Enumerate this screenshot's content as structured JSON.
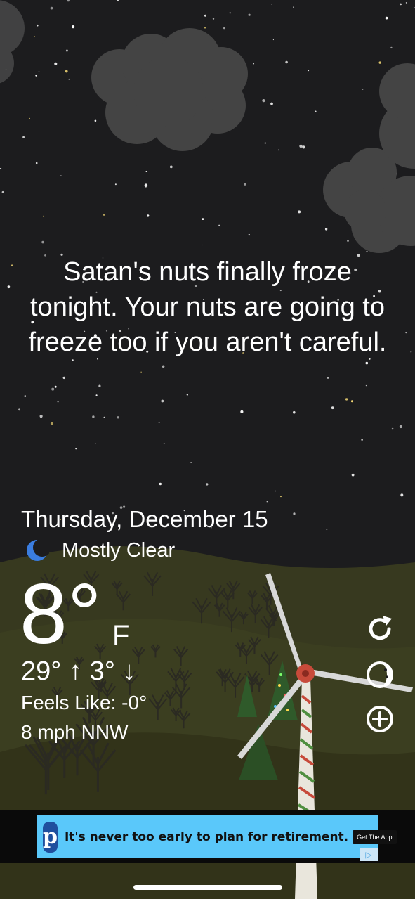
{
  "quote": "Satan's nuts finally froze tonight. Your nuts are going to freeze too if you aren't careful.",
  "date": "Thursday, December 15",
  "condition": {
    "icon": "moon-icon",
    "text": "Mostly Clear"
  },
  "temperature": {
    "value": "8°",
    "unit": "F"
  },
  "hi_lo": "29° ↑  3° ↓",
  "feels_like": "Feels Like: -0°",
  "wind": "8 mph NNW",
  "side_buttons": [
    "refresh-icon",
    "moon-phase-icon",
    "add-icon"
  ],
  "ad": {
    "logo_letter": "p",
    "text": "It's never too early to plan for retirement.",
    "cta": "Get The App",
    "choice_icon": "ad-choices-icon"
  },
  "colors": {
    "sky": "#1c1c1e",
    "hills": "#3a3a1e",
    "moon": "#3a7de0"
  }
}
